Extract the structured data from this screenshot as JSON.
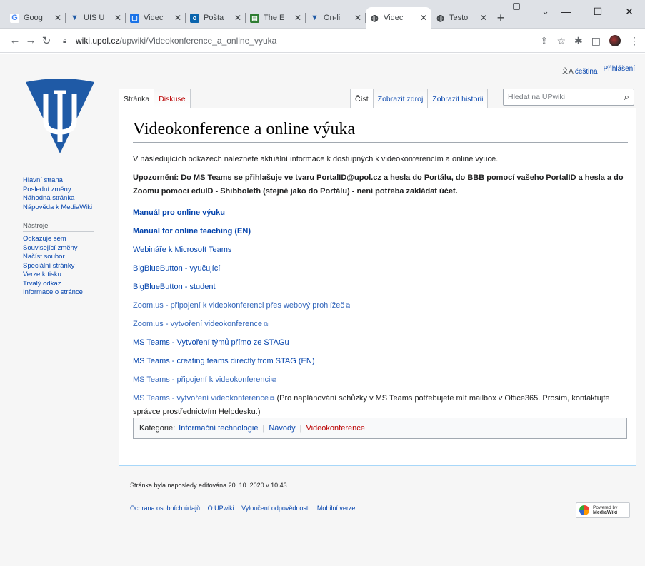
{
  "browser": {
    "tabs": [
      {
        "label": "Goog",
        "favicon": "google-icon",
        "color": "#4285f4",
        "glyph": "G"
      },
      {
        "label": "UIS U",
        "favicon": "upol-icon",
        "color": "#1f5aa6",
        "glyph": "▼"
      },
      {
        "label": "Videc",
        "favicon": "video-icon",
        "color": "#1a73e8",
        "glyph": "▢"
      },
      {
        "label": "Pošta",
        "favicon": "outlook-icon",
        "color": "#0a64ad",
        "glyph": "o"
      },
      {
        "label": "The E",
        "favicon": "doc-icon",
        "color": "#2e7d32",
        "glyph": "▤"
      },
      {
        "label": "On-li",
        "favicon": "upol-icon",
        "color": "#1f5aa6",
        "glyph": "▼"
      },
      {
        "label": "Videc",
        "favicon": "globe-icon",
        "color": "#3c4043",
        "glyph": "◍",
        "active": true
      },
      {
        "label": "Testo",
        "favicon": "globe-icon",
        "color": "#3c4043",
        "glyph": "◍"
      }
    ],
    "new_tab": "+",
    "url_domain": "wiki.upol.cz",
    "url_path": "/upwiki/Videokonference_a_online_vyuka"
  },
  "page": {
    "personal": {
      "language": "čeština",
      "login": "Přihlášení"
    },
    "left_tabs": [
      "Stránka",
      "Diskuse"
    ],
    "right_tabs": [
      "Číst",
      "Zobrazit zdroj",
      "Zobrazit historii"
    ],
    "search_placeholder": "Hledat na UPwiki",
    "sidebar": {
      "nav": [
        "Hlavní strana",
        "Poslední změny",
        "Náhodná stránka",
        "Nápověda k MediaWiki"
      ],
      "tools_heading": "Nástroje",
      "tools": [
        "Odkazuje sem",
        "Související změny",
        "Načíst soubor",
        "Speciální stránky",
        "Verze k tisku",
        "Trvalý odkaz",
        "Informace o stránce"
      ]
    },
    "title": "Videokonference a online výuka",
    "intro": "V následujících odkazech naleznete aktuální informace k dostupných k videokonferencím a online výuce.",
    "notice": "Upozornění: Do MS Teams se přihlašuje ve tvaru PortalID@upol.cz a hesla do Portálu, do BBB pomocí vašeho PortalID a hesla a do Zoomu pomoci eduID - Shibboleth (stejně jako do Portálu) - není potřeba zakládat účet.",
    "links": [
      "Manuál pro online výuku",
      "Manual for online teaching (EN)",
      "Webináře k Microsoft Teams",
      "BigBlueButton - vyučující",
      "BigBlueButton - student",
      "Zoom.us - připojení k videokonferenci přes webový prohlížeč",
      "Zoom.us - vytvoření videokonference",
      "MS Teams - Vytvoření týmů přímo ze STAGu",
      "MS Teams - creating teams directly from STAG (EN)",
      "MS Teams - připojení k videokonferenci",
      "MS Teams - vytvoření videokonference"
    ],
    "last_note": " (Pro naplánování schůzky v MS Teams potřebujete mít mailbox v Office365. Prosím, kontaktujte správce prostřednictvím Helpdesku.)",
    "categories": {
      "label": "Kategorie:",
      "items": [
        "Informační technologie",
        "Návody",
        "Videokonference"
      ]
    },
    "footer": {
      "lastmod": "Stránka byla naposledy editována 20. 10. 2020 v 10:43.",
      "places": [
        "Ochrana osobních údajů",
        "O UPwiki",
        "Vyloučení odpovědnosti",
        "Mobilní verze"
      ],
      "powered_line1": "Powered by",
      "powered_line2": "MediaWiki"
    }
  }
}
